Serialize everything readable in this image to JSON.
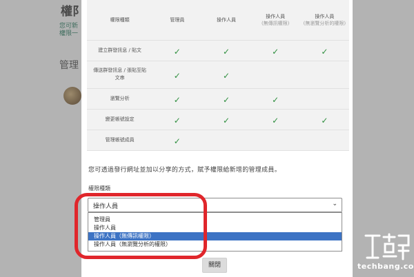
{
  "background": {
    "title": "權阝",
    "subtitle_1": "您可新",
    "subtitle_2": "權限一",
    "heading": "管理"
  },
  "table": {
    "headers": [
      {
        "main": "權限種類",
        "sub": ""
      },
      {
        "main": "管理員",
        "sub": ""
      },
      {
        "main": "操作人員",
        "sub": ""
      },
      {
        "main": "操作人員",
        "sub": "(無傳訊權限)"
      },
      {
        "main": "操作人員",
        "sub": "(無瀏覽分析的權限)"
      }
    ],
    "rows": [
      {
        "name": "建立群發訊息 / 貼文",
        "checks": [
          true,
          true,
          true,
          true
        ]
      },
      {
        "name": "傳送群發訊息 / 張貼至貼文串",
        "checks": [
          true,
          true,
          false,
          false
        ]
      },
      {
        "name": "瀏覽分析",
        "checks": [
          true,
          true,
          true,
          false
        ]
      },
      {
        "name": "變更帳號設定",
        "checks": [
          true,
          true,
          true,
          true
        ]
      },
      {
        "name": "管理帳號成員",
        "checks": [
          true,
          false,
          false,
          false
        ]
      }
    ],
    "check_symbol": "✓"
  },
  "hint": "您可透過發行網址並加以分享的方式，賦予權限給新增的管理成員。",
  "role_field": {
    "label": "權限種類",
    "value": "操作人員",
    "options": [
      "管理員",
      "操作人員",
      "操作人員（無傳訊權限）",
      "操作人員（無瀏覽分析的權限）"
    ],
    "highlighted_index": 2
  },
  "close_button": "關閉",
  "watermark": {
    "text": "techbang.com",
    "logo": "T客邦"
  },
  "colors": {
    "highlight_ring": "#e0262b",
    "check": "#2f8f3f",
    "selected_option": "#3d73c4"
  }
}
